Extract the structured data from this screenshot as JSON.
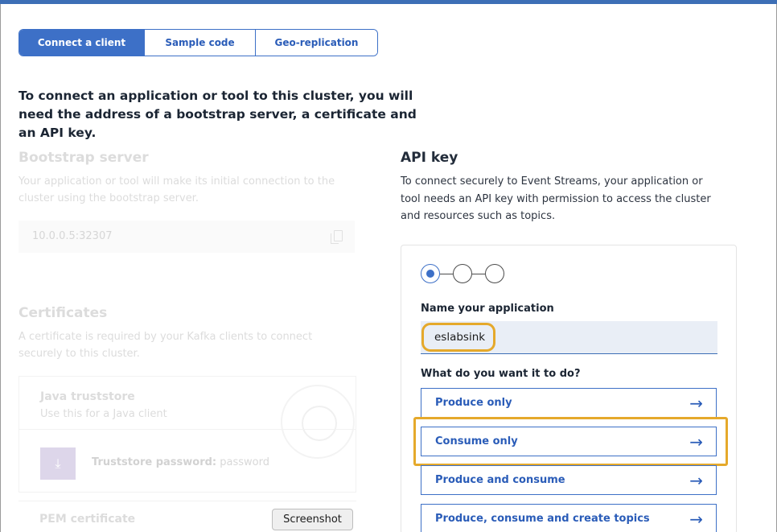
{
  "tabs": [
    {
      "label": "Connect a client",
      "active": true
    },
    {
      "label": "Sample code",
      "active": false
    },
    {
      "label": "Geo-replication",
      "active": false
    }
  ],
  "intro": "To connect an application or tool to this cluster, you will need the address of a bootstrap server, a certificate and an API key.",
  "bootstrap": {
    "title": "Bootstrap server",
    "description": "Your application or tool will make its initial connection to the cluster using the bootstrap server.",
    "address": "10.0.0.5:32307"
  },
  "certificates": {
    "title": "Certificates",
    "description": "A certificate is required by your Kafka clients to connect securely to this cluster.",
    "java_title": "Java truststore",
    "java_subtitle": "Use this for a Java client",
    "password_label": "Truststore password:",
    "password_value": "password",
    "pem_title": "PEM certificate"
  },
  "tooltip": "Screenshot",
  "api_key": {
    "title": "API key",
    "description": "To connect securely to Event Streams, your application or tool needs an API key with permission to access the cluster and resources such as topics.",
    "name_label": "Name your application",
    "name_value": "eslabsink",
    "question": "What do you want it to do?",
    "options": [
      {
        "label": "Produce only"
      },
      {
        "label": "Consume only"
      },
      {
        "label": "Produce and consume"
      },
      {
        "label": "Produce, consume and create topics"
      }
    ],
    "current_step": 1,
    "total_steps": 3
  },
  "colors": {
    "accent": "#3d70c7",
    "highlight": "#e5a92b",
    "top_bar": "#3d6fb6"
  },
  "icons": [
    "copy-icon",
    "download-icon",
    "certificate-badge-icon",
    "arrow-right-icon"
  ]
}
